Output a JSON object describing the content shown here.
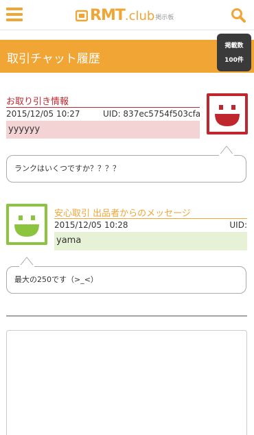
{
  "header": {
    "logo_main": "RMT",
    "logo_club": ".club",
    "logo_sub": "掲示板",
    "brand_color": "#f0a535"
  },
  "titlebar": {
    "title": "取引チャット履歴",
    "count_label": "掲載数",
    "count_value": "100件"
  },
  "trade_info": {
    "title": "お取り引き情報",
    "date": "2015/12/05 10:27",
    "uid": "UID: 837ec5754f503cfa",
    "username": "yyyyyy",
    "accent": "#c0262d",
    "avatar_icon": "smiley-face-icon"
  },
  "messages": [
    {
      "text": "ランクはいくつですか？？？？"
    },
    {
      "text": "最大の250です（>_<）"
    }
  ],
  "seller": {
    "title": "安心取引 出品者からのメッセージ",
    "date": "2015/12/05 10:28",
    "uid": "UID:",
    "username": "yama",
    "accent": "#8dc43f",
    "avatar_icon": "smiley-face-icon"
  },
  "reply": {
    "placeholder": ""
  }
}
